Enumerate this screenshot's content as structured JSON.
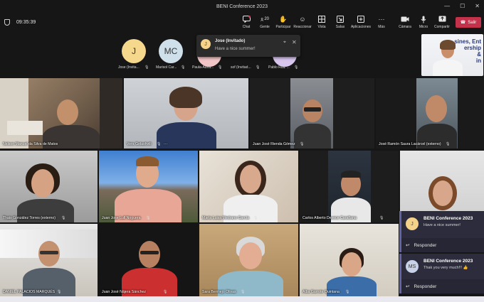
{
  "window": {
    "title": "BENI Conference 2023",
    "clock": "09:35:39",
    "minimize": "—",
    "maximize": "☐",
    "close": "✕"
  },
  "toolbar": {
    "chat": "Chat",
    "people": "Gente",
    "people_count": "20",
    "raise": "Participar",
    "react": "Reaccionar",
    "view": "Vista",
    "rooms": "Salas",
    "apps": "Aplicaciones",
    "more": "Más",
    "camera": "Cámara",
    "mic": "Micro",
    "share": "Compartir",
    "leave": "Salir"
  },
  "participants_row": [
    {
      "initials": "J",
      "name": "Jose (Invita...",
      "color": "#f6d88d"
    },
    {
      "initials": "MC",
      "name": "Marisol Car...",
      "color": "#cfe0ea"
    },
    {
      "initials": "",
      "name": "Paula-Adria...",
      "color": "#f2c6c6"
    },
    {
      "initials": "",
      "name": "sof (Invitad...",
      "color": "#d8c6ee"
    },
    {
      "initials": "",
      "name": "Pablo Ruiz ...",
      "color": "#f2e1b8"
    }
  ],
  "toast": {
    "initials": "J",
    "name": "Jose (Invitado)",
    "message": "Have a nice summer!"
  },
  "self_view_text": "sines, Ent\nership\n&\nin",
  "tiles": [
    {
      "name": "Nelson Manuel da Silva de Matos"
    },
    {
      "name": "Vera Gelashvili",
      "more": "···"
    },
    {
      "name": "Juan José Rienda Gómez"
    },
    {
      "name": "José Ramón Saura Lacárcel (externo)"
    },
    {
      "name": "Thais González Torres (externo)"
    },
    {
      "name": "Juan Jose Lull Noguera"
    },
    {
      "name": "María Luisa Medrano García"
    },
    {
      "name": "Carlos Alberto Devece Carañana"
    },
    {
      "name": ""
    },
    {
      "name": "DANIEL PALACIOS MARQUÉS"
    },
    {
      "name": "Juan José Nájera Sánchez"
    },
    {
      "name": "Sara Bermejo Olivas"
    },
    {
      "name": "Alba Garrote Quintana"
    }
  ],
  "chat_notifications": [
    {
      "initials": "J",
      "title": "BENI Conference 2023",
      "message": "Have a nice summer!",
      "reply": "Responder",
      "avatar_color": "#f5d28a"
    },
    {
      "initials": "MS",
      "title": "BENI Conference 2023",
      "message": "Thak you very much!!! 👍",
      "reply": "Responder",
      "avatar_color": "#c7d2e8"
    }
  ],
  "icons": {
    "mic": "🎙",
    "pin": "📌"
  }
}
